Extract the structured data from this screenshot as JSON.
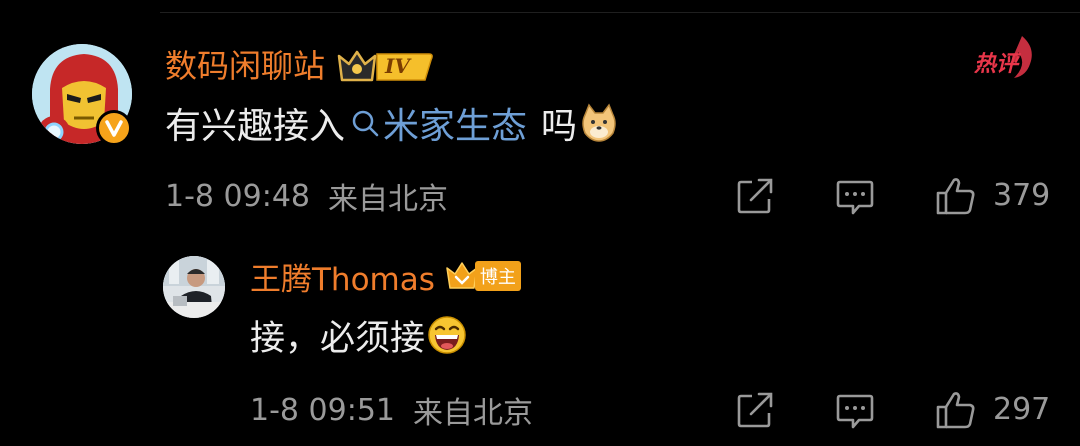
{
  "comment": {
    "author": "数码闲聊站",
    "level_badge": "IV",
    "hot_label": "热评",
    "text_before": "有兴趣接入",
    "topic_link": "米家生态",
    "text_after": "吗",
    "emoji": "doge-emoji",
    "time": "1-8 09:48",
    "location": "来自北京",
    "likes": "379"
  },
  "reply": {
    "author": "王腾Thomas",
    "badge_label": "博主",
    "text": "接，必须接",
    "emoji": "laughing-emoji",
    "time": "1-8 09:51",
    "location": "来自北京",
    "likes": "297"
  },
  "colors": {
    "background": "#000000",
    "username": "#ef7d2c",
    "link": "#6e9fd6",
    "meta": "#9a9a9a",
    "hot": "#e8364a"
  }
}
